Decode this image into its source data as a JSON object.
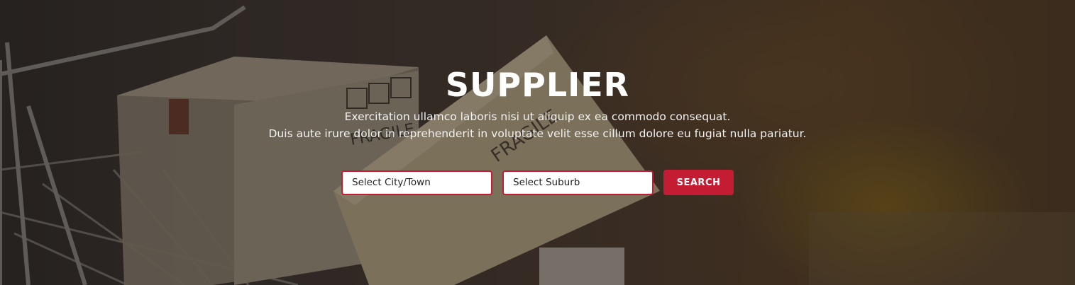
{
  "hero": {
    "title": "SUPPLIER",
    "subtitle_line1": "Exercitation ullamco laboris nisi ut aliquip ex ea commodo consequat.",
    "subtitle_line2": "Duis aute irure dolor in reprehenderit in voluptate velit esse cillum dolore eu fugiat nulla pariatur.",
    "background_image": "cardboard-boxes-in-shopping-cart",
    "box_print": "FRAGILE"
  },
  "search": {
    "city_select": "Select City/Town",
    "suburb_select": "Select Suburb",
    "button_label": "SEARCH"
  },
  "colors": {
    "accent": "#c41c32",
    "title_text": "#ffffff"
  }
}
